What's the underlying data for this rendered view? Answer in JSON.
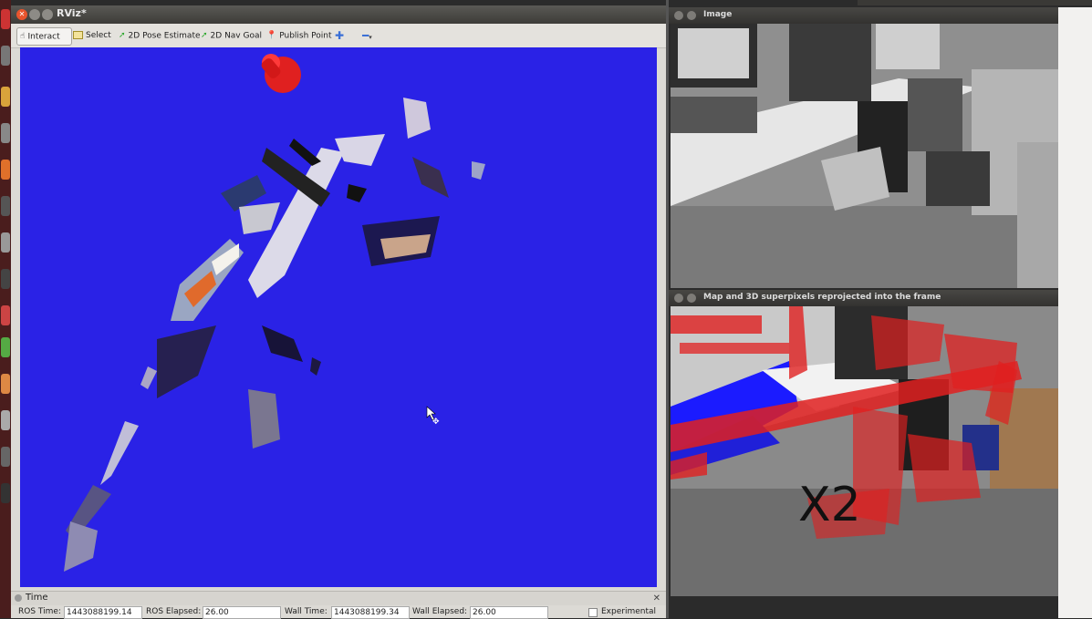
{
  "rviz": {
    "title": "RViz*",
    "toolbar": {
      "interact": "Interact",
      "select": "Select",
      "pose_estimate": "2D Pose Estimate",
      "nav_goal": "2D Nav Goal",
      "publish_point": "Publish Point"
    },
    "time_panel": {
      "title": "Time",
      "ros_time_label": "ROS Time:",
      "ros_time_value": "1443088199.14",
      "ros_elapsed_label": "ROS Elapsed:",
      "ros_elapsed_value": "26.00",
      "wall_time_label": "Wall Time:",
      "wall_time_value": "1443088199.34",
      "wall_elapsed_label": "Wall Elapsed:",
      "wall_elapsed_value": "26.00",
      "experimental_label": "Experimental"
    },
    "view_background": "#2a22e6"
  },
  "image_window": {
    "title": "Image"
  },
  "projection_window": {
    "title": "Map and 3D superpixels reprojected into the frame",
    "overlay_text": "X2"
  },
  "colors": {
    "accent_red": "#e02020",
    "close_orange": "#e9542d"
  }
}
